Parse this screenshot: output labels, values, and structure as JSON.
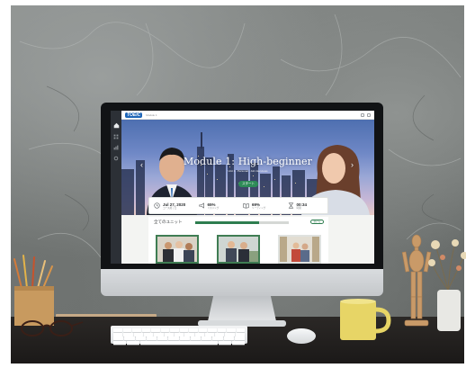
{
  "screen": {
    "topbar": {
      "logo": "TOEIC",
      "breadcrumb": "Module 1"
    },
    "sidebar": {
      "icons": [
        "home-icon",
        "grid-icon",
        "chart-icon",
        "gear-icon"
      ]
    },
    "hero": {
      "title": "Module 1: High-beginner",
      "subtitle": "Unit 1 · Personal · Job interviews",
      "button_label": "スタート",
      "prev_arrow": "‹",
      "next_arrow": "›"
    },
    "stats": [
      {
        "icon": "clock-icon",
        "value": "Jul 27, 2020",
        "label": "コース終了日"
      },
      {
        "icon": "megaphone-icon",
        "value": "65%",
        "label": "リスニング"
      },
      {
        "icon": "book-icon",
        "value": "69%",
        "label": "リーディング"
      },
      {
        "icon": "hourglass-icon",
        "value": "00:34",
        "label": "時間"
      }
    ],
    "units": {
      "heading": "全てのユニット",
      "progress": 0.68,
      "pill_label": "続ける",
      "thumbnails": [
        "unit-thumbnail-1",
        "unit-thumbnail-2",
        "unit-thumbnail-3"
      ]
    },
    "colors": {
      "accent_green": "#2e7d4f",
      "sidebar": "#2c3036",
      "hero_sky": "#6f88c6"
    }
  }
}
